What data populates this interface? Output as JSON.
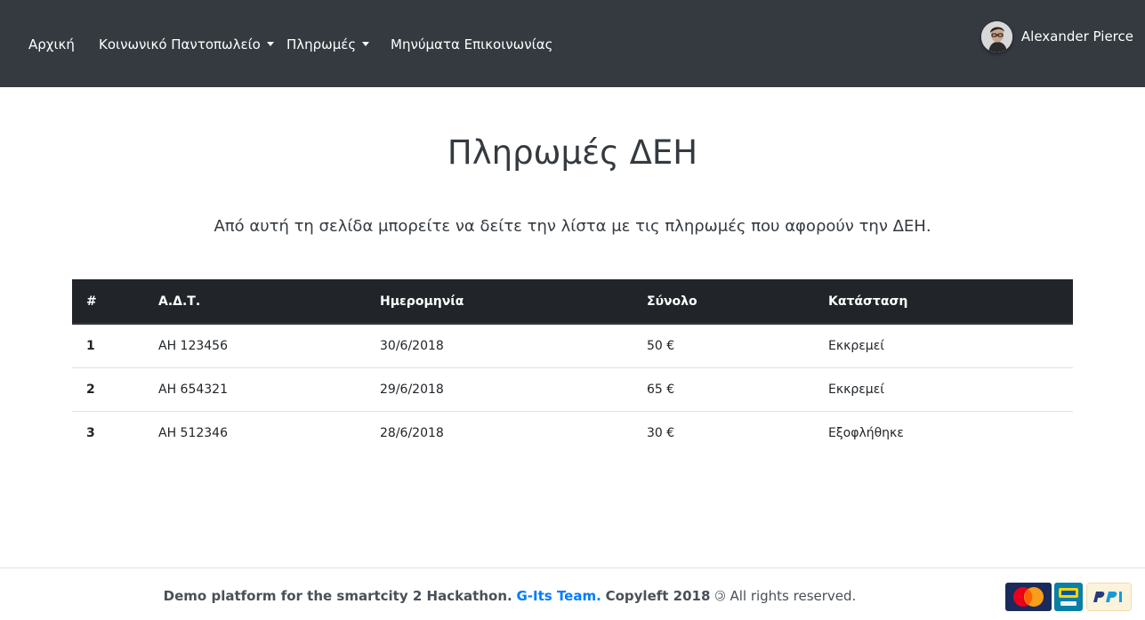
{
  "navbar": {
    "items": [
      {
        "label": "Αρχική",
        "dropdown": false
      },
      {
        "label": "Κοινωνικό Παντοπωλείο",
        "dropdown": true
      },
      {
        "label": "Πληρωμές",
        "dropdown": true
      },
      {
        "label": "Μηνύματα Επικοινωνίας",
        "dropdown": false
      }
    ],
    "user": {
      "name": "Alexander Pierce",
      "icon": "user-avatar"
    }
  },
  "page": {
    "title": "Πληρωμές ΔΕΗ",
    "lead": "Από αυτή τη σελίδα μπορείτε να δείτε την λίστα με τις πληρωμές που αφορούν την ΔΕΗ."
  },
  "table": {
    "headers": [
      "#",
      "Α.Δ.Τ.",
      "Ημερομηνία",
      "Σύνολο",
      "Κατάσταση"
    ],
    "rows": [
      {
        "num": "1",
        "adt": "ΑΗ 123456",
        "date": "30/6/2018",
        "total": "50 €",
        "status": "Εκκρεμεί",
        "status_type": "pending"
      },
      {
        "num": "2",
        "adt": "ΑΗ 654321",
        "date": "29/6/2018",
        "total": "65 €",
        "status": "Εκκρεμεί",
        "status_type": "pending"
      },
      {
        "num": "3",
        "adt": "ΑΗ 512346",
        "date": "28/6/2018",
        "total": "30 €",
        "status": "Εξοφλήθηκε",
        "status_type": "paid"
      }
    ]
  },
  "footer": {
    "text_prefix": "Demo platform for the smartcity 2 Hackathon.",
    "team": "G-Its Team.",
    "copyleft": "Copyleft 2018",
    "copyleft_symbol": "🄯",
    "rights": "All rights reserved.",
    "payment_icons": [
      "mastercard-icon",
      "ikea-pay-icon",
      "paypal-icon"
    ]
  },
  "colors": {
    "navbar_bg": "#343a40",
    "table_head_bg": "#212529",
    "paid": "#28a745",
    "link": "#007bff"
  }
}
